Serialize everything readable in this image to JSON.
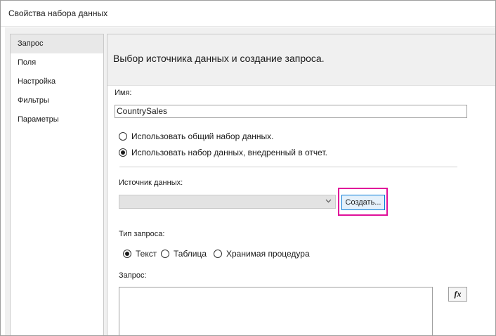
{
  "window": {
    "title": "Свойства набора данных"
  },
  "sidebar": {
    "items": [
      {
        "label": "Запрос"
      },
      {
        "label": "Поля"
      },
      {
        "label": "Настройка"
      },
      {
        "label": "Фильтры"
      },
      {
        "label": "Параметры"
      }
    ],
    "active_index": 0
  },
  "main": {
    "header": "Выбор источника данных и создание запроса.",
    "name_label": "Имя:",
    "name_value": "CountrySales",
    "radio_shared": "Использовать общий набор данных.",
    "radio_embedded": "Использовать набор данных, внедренный в отчет.",
    "datasource_label": "Источник данных:",
    "datasource_value": "",
    "create_button": "Создать...",
    "query_type_label": "Тип запроса:",
    "query_type_text": "Текст",
    "query_type_table": "Таблица",
    "query_type_sp": "Хранимая процедура",
    "query_label": "Запрос:",
    "query_value": "",
    "fx_button": "fx"
  },
  "colors": {
    "highlight": "#e0109a",
    "button_border": "#0078d7",
    "button_fill": "#e5f1fb"
  }
}
